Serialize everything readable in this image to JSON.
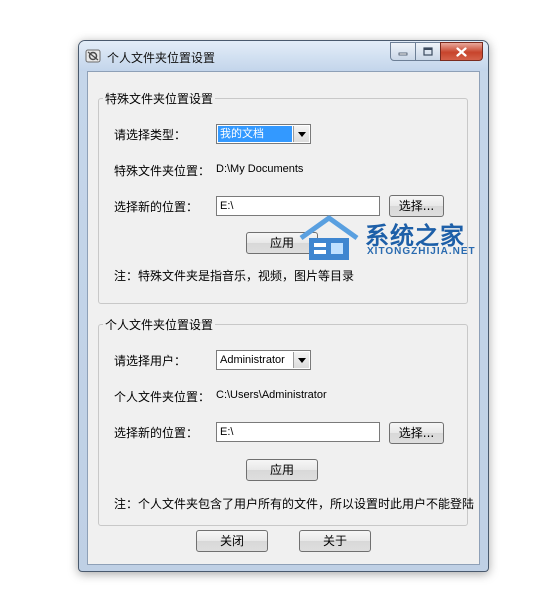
{
  "window": {
    "title": "个人文件夹位置设置"
  },
  "special_group": {
    "legend": "特殊文件夹位置设置",
    "type_label": "请选择类型：",
    "type_value": "我的文档",
    "location_label": "特殊文件夹位置：",
    "location_value": "D:\\My Documents",
    "new_location_label": "选择新的位置：",
    "new_location_value": "E:\\",
    "browse_label": "选择...",
    "apply_label": "应用",
    "note": "注：特殊文件夹是指音乐，视频，图片等目录"
  },
  "personal_group": {
    "legend": "个人文件夹位置设置",
    "user_label": "请选择用户：",
    "user_value": "Administrator",
    "location_label": "个人文件夹位置：",
    "location_value": "C:\\Users\\Administrator",
    "new_location_label": "选择新的位置：",
    "new_location_value": "E:\\",
    "browse_label": "选择...",
    "apply_label": "应用",
    "note": "注：个人文件夹包含了用户所有的文件，所以设置时此用户不能登陆"
  },
  "footer": {
    "close_label": "关闭",
    "about_label": "关于"
  },
  "watermark": {
    "title": "系统之家",
    "subtitle": "XITONGZHIJIA.NET"
  },
  "icons": {
    "app": "app-gear-icon",
    "minimize": "minimize-icon",
    "maximize": "maximize-icon",
    "close": "close-icon",
    "dropdown": "chevron-down-icon"
  },
  "colors": {
    "selection": "#3399ff",
    "close_button": "#c7442c",
    "title_bar": "#c3d5eb",
    "client_bg": "#f0f0f0",
    "watermark": "#1d5fa8"
  }
}
